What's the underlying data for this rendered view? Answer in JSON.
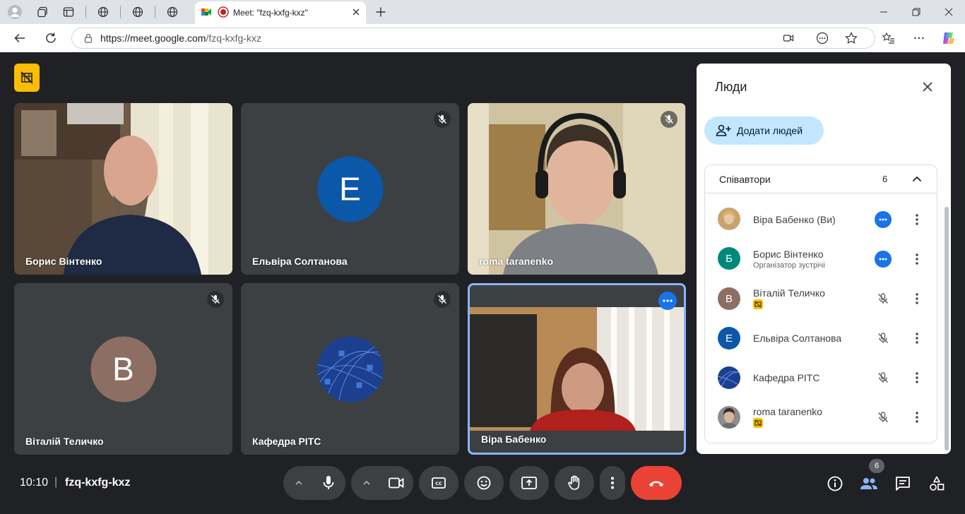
{
  "browser": {
    "tab_title": "Meet: \"fzq-kxfg-kxz\"",
    "url_host": "https://meet.google.com",
    "url_path": "/fzq-kxfg-kxz"
  },
  "tiles": [
    {
      "name": "Борис Вінтенко",
      "type": "video",
      "muted": false
    },
    {
      "name": "Ельвіра Солтанова",
      "type": "avatar",
      "initial": "E",
      "color": "#0b57a8",
      "muted": true
    },
    {
      "name": "roma taranenko",
      "type": "video",
      "muted": true
    },
    {
      "name": "Віталій Теличко",
      "type": "avatar",
      "initial": "B",
      "color": "#8d6e63",
      "muted": true
    },
    {
      "name": "Кафедра PITC",
      "type": "image-avatar",
      "muted": true
    },
    {
      "name": "Віра Бабенко",
      "type": "video",
      "muted": false,
      "active": true
    }
  ],
  "panel": {
    "title": "Люди",
    "add_people": "Додати людей",
    "section_label": "Співавтори",
    "section_count": "6",
    "people": [
      {
        "name": "Віра Бабенко (Ви)",
        "sub": "",
        "avatar": "photo",
        "action": "more"
      },
      {
        "name": "Борис Вінтенко",
        "sub": "Організатор зустрічі",
        "initial": "Б",
        "color": "#00897b",
        "action": "more"
      },
      {
        "name": "Віталій Теличко",
        "sub": "",
        "initial": "В",
        "color": "#8d6e63",
        "action": "muted",
        "badge": true
      },
      {
        "name": "Ельвіра Солтанова",
        "sub": "",
        "initial": "E",
        "color": "#0b57a8",
        "action": "muted"
      },
      {
        "name": "Кафедра PITC",
        "sub": "",
        "avatar": "image",
        "action": "muted"
      },
      {
        "name": "roma taranenko",
        "sub": "",
        "avatar": "photo2",
        "action": "muted",
        "badge": true
      }
    ]
  },
  "bottom": {
    "time": "10:10",
    "separator": "|",
    "meeting_code": "fzq-kxfg-kxz",
    "people_count": "6"
  },
  "colors": {
    "end_call": "#ea4335",
    "accent": "#1a73e8",
    "yellow": "#fbbc04"
  }
}
